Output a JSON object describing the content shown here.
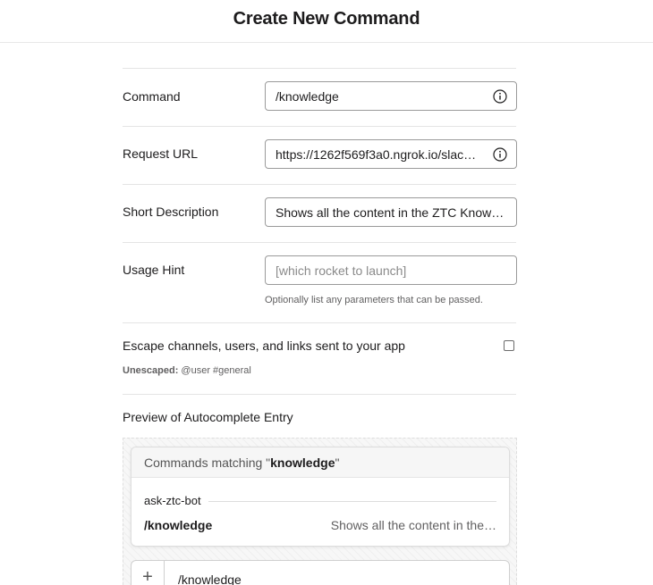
{
  "header": {
    "title": "Create New Command"
  },
  "form": {
    "command": {
      "label": "Command",
      "value": "/knowledge",
      "icon": "info-icon"
    },
    "request_url": {
      "label": "Request URL",
      "value": "https://1262f569f3a0.ngrok.io/slac…",
      "icon": "info-icon"
    },
    "short_description": {
      "label": "Short Description",
      "value": "Shows all the content in the ZTC Knowl…"
    },
    "usage_hint": {
      "label": "Usage Hint",
      "placeholder": "[which rocket to launch]",
      "help": "Optionally list any parameters that can be passed."
    },
    "escape": {
      "label": "Escape channels, users, and links sent to your app",
      "checked": false,
      "note_prefix": "Unescaped:",
      "note_value": "@user #general"
    }
  },
  "preview": {
    "title": "Preview of Autocomplete Entry",
    "matching_prefix": "Commands matching \"",
    "matching_query": "knowledge",
    "matching_suffix": "\"",
    "app_name": "ask-ztc-bot",
    "command": "/knowledge",
    "description": "Shows all the content in the…",
    "composer_icon": "plus-icon",
    "composer_text": "/knowledge"
  }
}
